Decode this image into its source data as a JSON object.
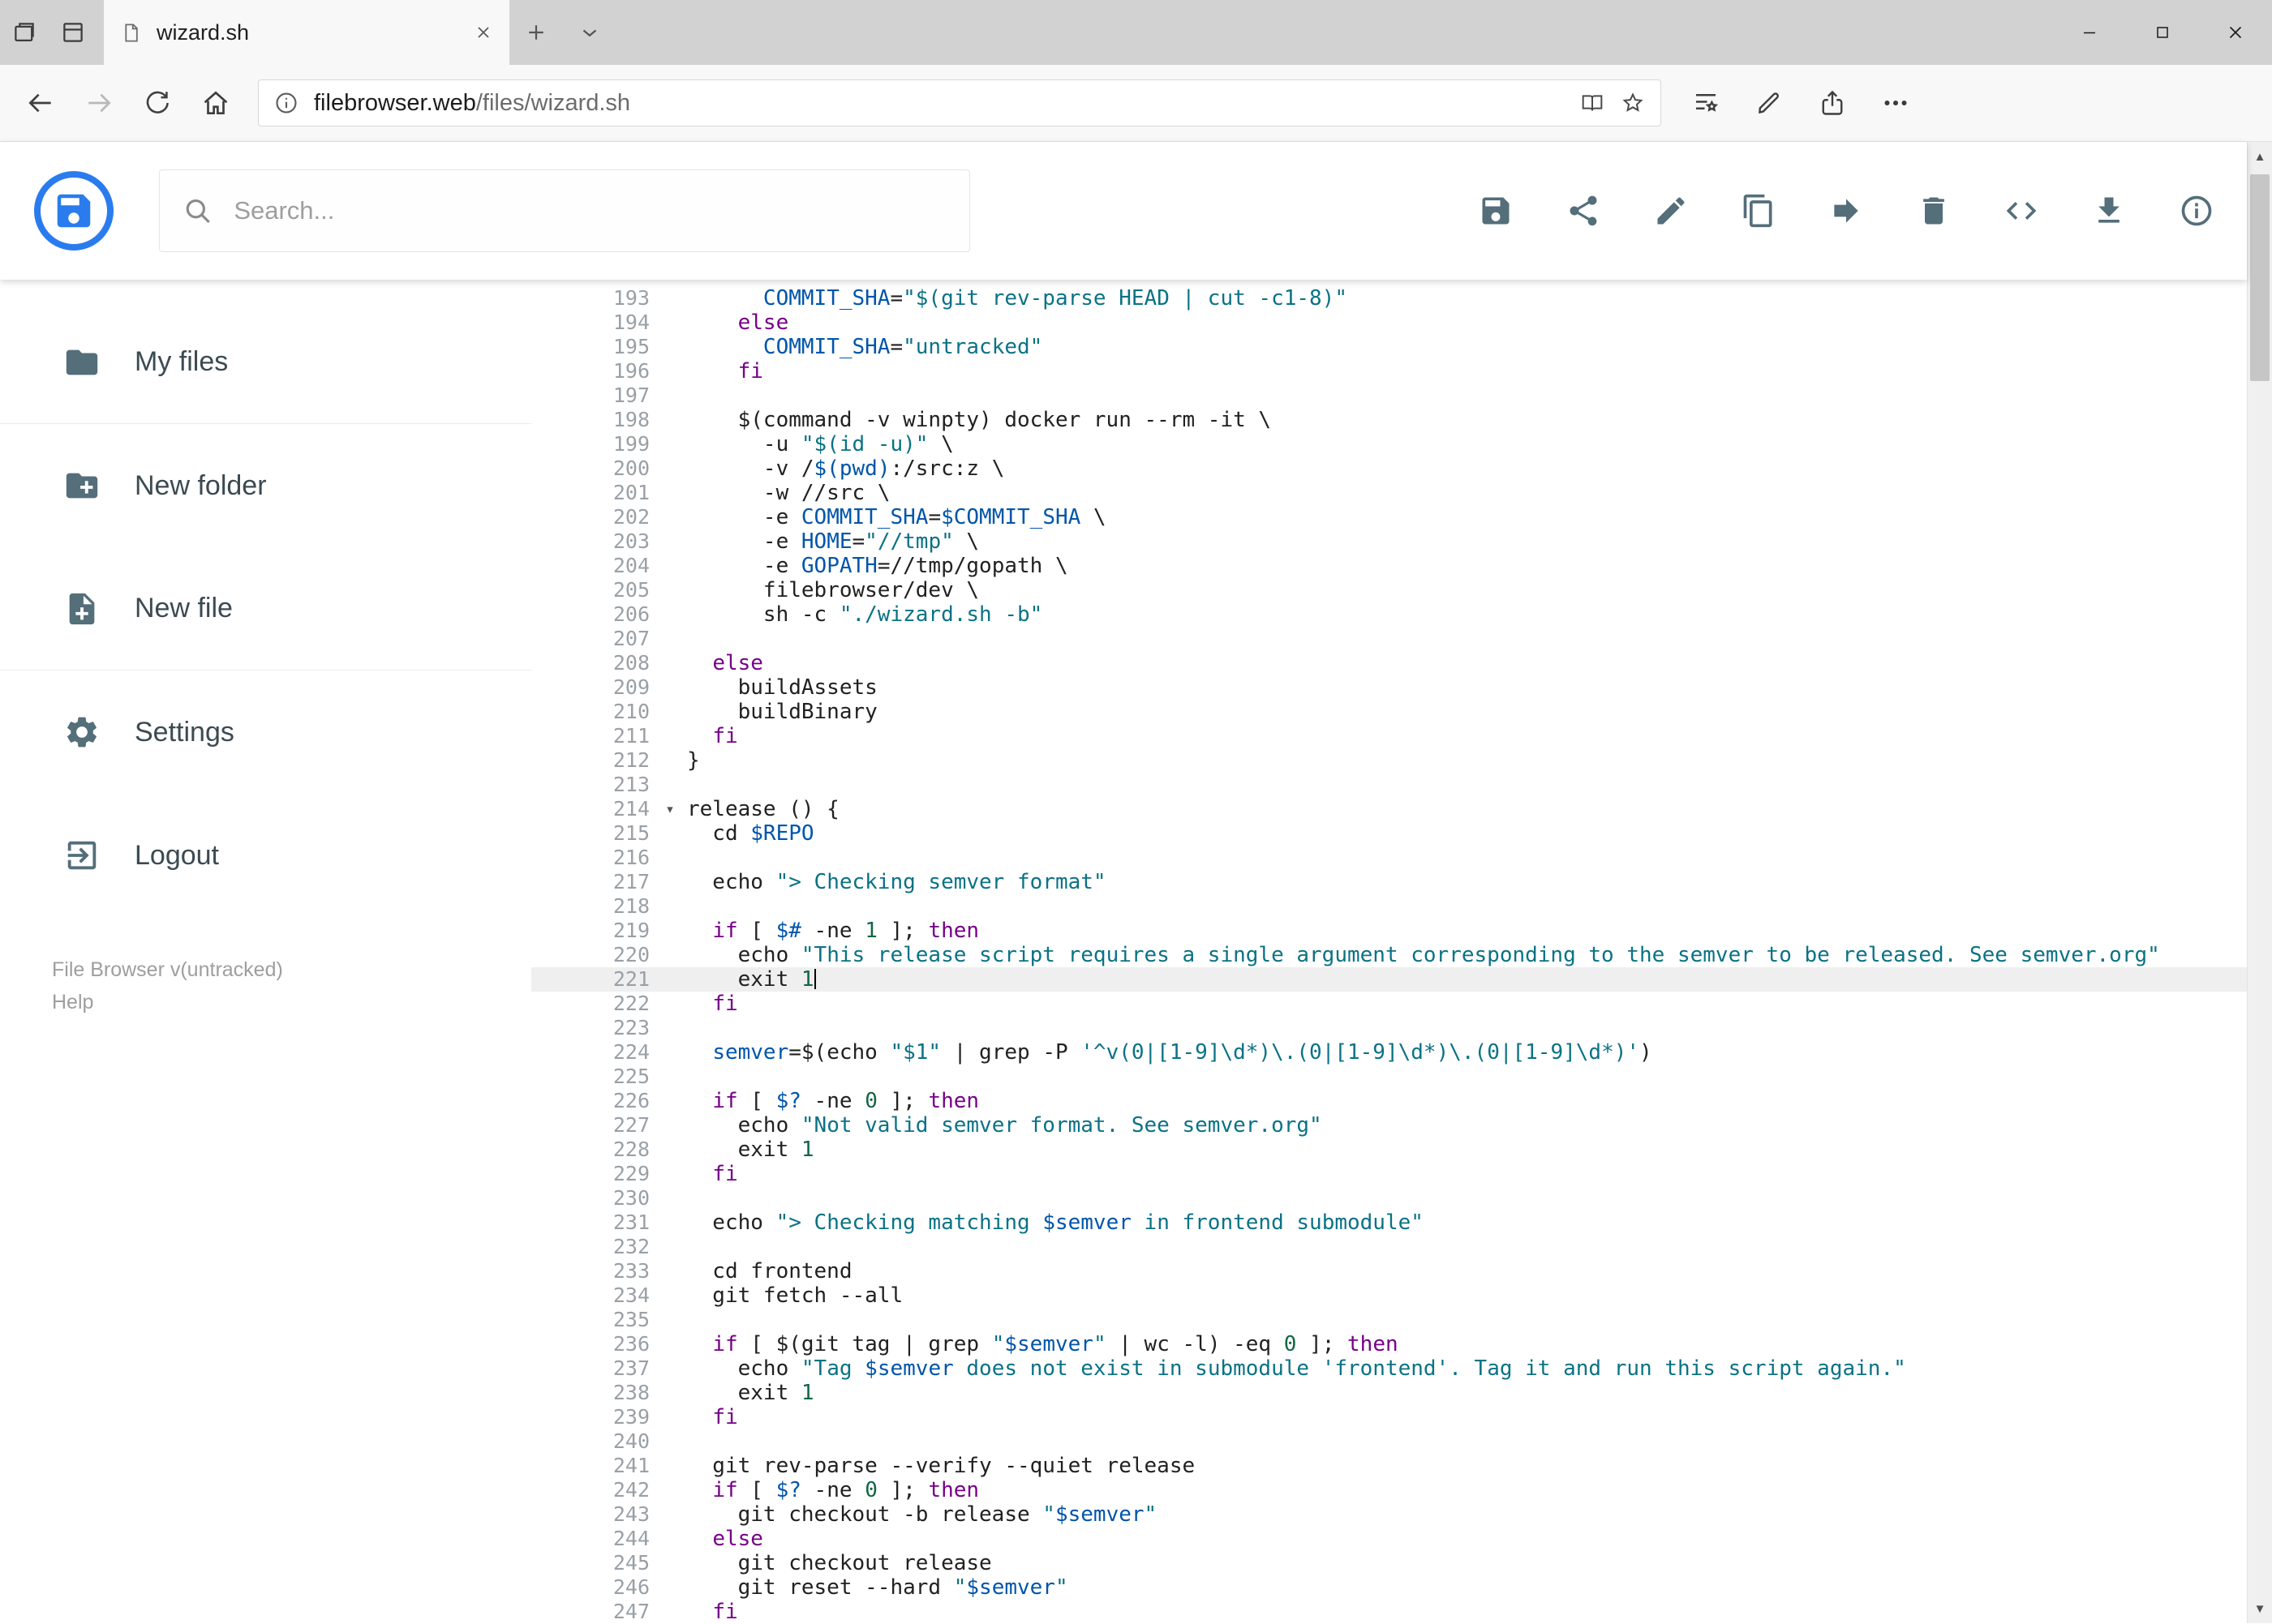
{
  "chrome": {
    "tab_title": "wizard.sh",
    "url_host": "filebrowser.web",
    "url_path": "/files/wizard.sh",
    "window_controls": [
      "minimize",
      "maximize",
      "close"
    ],
    "nav_buttons": [
      "back",
      "forward",
      "refresh",
      "home"
    ],
    "address_icons": [
      "info",
      "reading-view",
      "favorite-star"
    ],
    "toolbar_icons": [
      "hub",
      "web-notes",
      "share",
      "more"
    ]
  },
  "header": {
    "search_placeholder": "Search...",
    "actions": [
      "save",
      "share",
      "rename",
      "copy",
      "move",
      "delete",
      "switch-view",
      "download",
      "info"
    ]
  },
  "sidebar": {
    "items": [
      {
        "icon": "folder",
        "label": "My files"
      },
      {
        "icon": "new-folder",
        "label": "New folder"
      },
      {
        "icon": "new-file",
        "label": "New file"
      },
      {
        "icon": "settings",
        "label": "Settings"
      },
      {
        "icon": "logout",
        "label": "Logout"
      }
    ],
    "footer_version": "File Browser v(untracked)",
    "footer_help": "Help"
  },
  "colors": {
    "accent_blue": "#2a7cee",
    "icon_gray": "#546e7a",
    "keyword": "#770088",
    "string": "#0b7285",
    "variable": "#0055aa",
    "number": "#116644",
    "active_line_bg": "#efefef"
  },
  "editor": {
    "active_line": 221,
    "cursor_line": 221,
    "fold_line": 214,
    "lines": [
      {
        "n": 193,
        "t": [
          [
            "p",
            "      "
          ],
          [
            "v",
            "COMMIT_SHA"
          ],
          [
            "p",
            "="
          ],
          [
            "s",
            "\"$(git rev-parse HEAD | cut -c1-8)\""
          ]
        ]
      },
      {
        "n": 194,
        "t": [
          [
            "p",
            "    "
          ],
          [
            "k",
            "else"
          ]
        ]
      },
      {
        "n": 195,
        "t": [
          [
            "p",
            "      "
          ],
          [
            "v",
            "COMMIT_SHA"
          ],
          [
            "p",
            "="
          ],
          [
            "s",
            "\"untracked\""
          ]
        ]
      },
      {
        "n": 196,
        "t": [
          [
            "p",
            "    "
          ],
          [
            "k",
            "fi"
          ]
        ]
      },
      {
        "n": 197,
        "t": []
      },
      {
        "n": 198,
        "t": [
          [
            "p",
            "    $(command -v winpty) docker run --rm -it \\"
          ]
        ]
      },
      {
        "n": 199,
        "t": [
          [
            "p",
            "      -u "
          ],
          [
            "s",
            "\"$(id -u)\""
          ],
          [
            "p",
            " \\"
          ]
        ]
      },
      {
        "n": 200,
        "t": [
          [
            "p",
            "      -v /"
          ],
          [
            "v",
            "$(pwd)"
          ],
          [
            "p",
            ":/src:z \\"
          ]
        ]
      },
      {
        "n": 201,
        "t": [
          [
            "p",
            "      -w //src \\"
          ]
        ]
      },
      {
        "n": 202,
        "t": [
          [
            "p",
            "      -e "
          ],
          [
            "v",
            "COMMIT_SHA"
          ],
          [
            "p",
            "="
          ],
          [
            "v",
            "$COMMIT_SHA"
          ],
          [
            "p",
            " \\"
          ]
        ]
      },
      {
        "n": 203,
        "t": [
          [
            "p",
            "      -e "
          ],
          [
            "v",
            "HOME"
          ],
          [
            "p",
            "="
          ],
          [
            "s",
            "\"//tmp\""
          ],
          [
            "p",
            " \\"
          ]
        ]
      },
      {
        "n": 204,
        "t": [
          [
            "p",
            "      -e "
          ],
          [
            "v",
            "GOPATH"
          ],
          [
            "p",
            "=//tmp/gopath \\"
          ]
        ]
      },
      {
        "n": 205,
        "t": [
          [
            "p",
            "      filebrowser/dev \\"
          ]
        ]
      },
      {
        "n": 206,
        "t": [
          [
            "p",
            "      sh -c "
          ],
          [
            "s",
            "\"./wizard.sh -b\""
          ]
        ]
      },
      {
        "n": 207,
        "t": []
      },
      {
        "n": 208,
        "t": [
          [
            "p",
            "  "
          ],
          [
            "k",
            "else"
          ]
        ]
      },
      {
        "n": 209,
        "t": [
          [
            "p",
            "    buildAssets"
          ]
        ]
      },
      {
        "n": 210,
        "t": [
          [
            "p",
            "    buildBinary"
          ]
        ]
      },
      {
        "n": 211,
        "t": [
          [
            "p",
            "  "
          ],
          [
            "k",
            "fi"
          ]
        ]
      },
      {
        "n": 212,
        "t": [
          [
            "p",
            "}"
          ]
        ]
      },
      {
        "n": 213,
        "t": []
      },
      {
        "n": 214,
        "t": [
          [
            "p",
            "release () {"
          ]
        ]
      },
      {
        "n": 215,
        "t": [
          [
            "p",
            "  cd "
          ],
          [
            "v",
            "$REPO"
          ]
        ]
      },
      {
        "n": 216,
        "t": []
      },
      {
        "n": 217,
        "t": [
          [
            "p",
            "  echo "
          ],
          [
            "s",
            "\"> Checking semver format\""
          ]
        ]
      },
      {
        "n": 218,
        "t": []
      },
      {
        "n": 219,
        "t": [
          [
            "p",
            "  "
          ],
          [
            "k",
            "if"
          ],
          [
            "p",
            " [ "
          ],
          [
            "v",
            "$#"
          ],
          [
            "p",
            " -ne "
          ],
          [
            "num",
            "1"
          ],
          [
            "p",
            " ]; "
          ],
          [
            "k",
            "then"
          ]
        ]
      },
      {
        "n": 220,
        "t": [
          [
            "p",
            "    echo "
          ],
          [
            "s",
            "\"This release script requires a single argument corresponding to the semver to be released. See semver.org\""
          ]
        ]
      },
      {
        "n": 221,
        "t": [
          [
            "p",
            "    exit "
          ],
          [
            "num",
            "1"
          ]
        ]
      },
      {
        "n": 222,
        "t": [
          [
            "p",
            "  "
          ],
          [
            "k",
            "fi"
          ]
        ]
      },
      {
        "n": 223,
        "t": []
      },
      {
        "n": 224,
        "t": [
          [
            "p",
            "  "
          ],
          [
            "v",
            "semver"
          ],
          [
            "p",
            "=$(echo "
          ],
          [
            "s",
            "\"$1\""
          ],
          [
            "p",
            " | grep -P "
          ],
          [
            "s",
            "'^v(0|[1-9]\\d*)\\.(0|[1-9]\\d*)\\.(0|[1-9]\\d*)'"
          ],
          [
            "p",
            ")"
          ]
        ]
      },
      {
        "n": 225,
        "t": []
      },
      {
        "n": 226,
        "t": [
          [
            "p",
            "  "
          ],
          [
            "k",
            "if"
          ],
          [
            "p",
            " [ "
          ],
          [
            "v",
            "$?"
          ],
          [
            "p",
            " -ne "
          ],
          [
            "num",
            "0"
          ],
          [
            "p",
            " ]; "
          ],
          [
            "k",
            "then"
          ]
        ]
      },
      {
        "n": 227,
        "t": [
          [
            "p",
            "    echo "
          ],
          [
            "s",
            "\"Not valid semver format. See semver.org\""
          ]
        ]
      },
      {
        "n": 228,
        "t": [
          [
            "p",
            "    exit "
          ],
          [
            "num",
            "1"
          ]
        ]
      },
      {
        "n": 229,
        "t": [
          [
            "p",
            "  "
          ],
          [
            "k",
            "fi"
          ]
        ]
      },
      {
        "n": 230,
        "t": []
      },
      {
        "n": 231,
        "t": [
          [
            "p",
            "  echo "
          ],
          [
            "s",
            "\"> Checking matching "
          ],
          [
            "v",
            "$semver"
          ],
          [
            "s",
            " in frontend submodule\""
          ]
        ]
      },
      {
        "n": 232,
        "t": []
      },
      {
        "n": 233,
        "t": [
          [
            "p",
            "  cd frontend"
          ]
        ]
      },
      {
        "n": 234,
        "t": [
          [
            "p",
            "  git fetch --all"
          ]
        ]
      },
      {
        "n": 235,
        "t": []
      },
      {
        "n": 236,
        "t": [
          [
            "p",
            "  "
          ],
          [
            "k",
            "if"
          ],
          [
            "p",
            " [ $(git tag | grep "
          ],
          [
            "s",
            "\""
          ],
          [
            "v",
            "$semver"
          ],
          [
            "s",
            "\""
          ],
          [
            "p",
            " | wc -l) -eq "
          ],
          [
            "num",
            "0"
          ],
          [
            "p",
            " ]; "
          ],
          [
            "k",
            "then"
          ]
        ]
      },
      {
        "n": 237,
        "t": [
          [
            "p",
            "    echo "
          ],
          [
            "s",
            "\"Tag "
          ],
          [
            "v",
            "$semver"
          ],
          [
            "s",
            " does not exist in submodule 'frontend'. Tag it and run this script again.\""
          ]
        ]
      },
      {
        "n": 238,
        "t": [
          [
            "p",
            "    exit "
          ],
          [
            "num",
            "1"
          ]
        ]
      },
      {
        "n": 239,
        "t": [
          [
            "p",
            "  "
          ],
          [
            "k",
            "fi"
          ]
        ]
      },
      {
        "n": 240,
        "t": []
      },
      {
        "n": 241,
        "t": [
          [
            "p",
            "  git rev-parse --verify --quiet release"
          ]
        ]
      },
      {
        "n": 242,
        "t": [
          [
            "p",
            "  "
          ],
          [
            "k",
            "if"
          ],
          [
            "p",
            " [ "
          ],
          [
            "v",
            "$?"
          ],
          [
            "p",
            " -ne "
          ],
          [
            "num",
            "0"
          ],
          [
            "p",
            " ]; "
          ],
          [
            "k",
            "then"
          ]
        ]
      },
      {
        "n": 243,
        "t": [
          [
            "p",
            "    git checkout -b release "
          ],
          [
            "s",
            "\""
          ],
          [
            "v",
            "$semver"
          ],
          [
            "s",
            "\""
          ]
        ]
      },
      {
        "n": 244,
        "t": [
          [
            "p",
            "  "
          ],
          [
            "k",
            "else"
          ]
        ]
      },
      {
        "n": 245,
        "t": [
          [
            "p",
            "    git checkout release"
          ]
        ]
      },
      {
        "n": 246,
        "t": [
          [
            "p",
            "    git reset --hard "
          ],
          [
            "s",
            "\""
          ],
          [
            "v",
            "$semver"
          ],
          [
            "s",
            "\""
          ]
        ]
      },
      {
        "n": 247,
        "t": [
          [
            "p",
            "  "
          ],
          [
            "k",
            "fi"
          ]
        ]
      }
    ]
  }
}
